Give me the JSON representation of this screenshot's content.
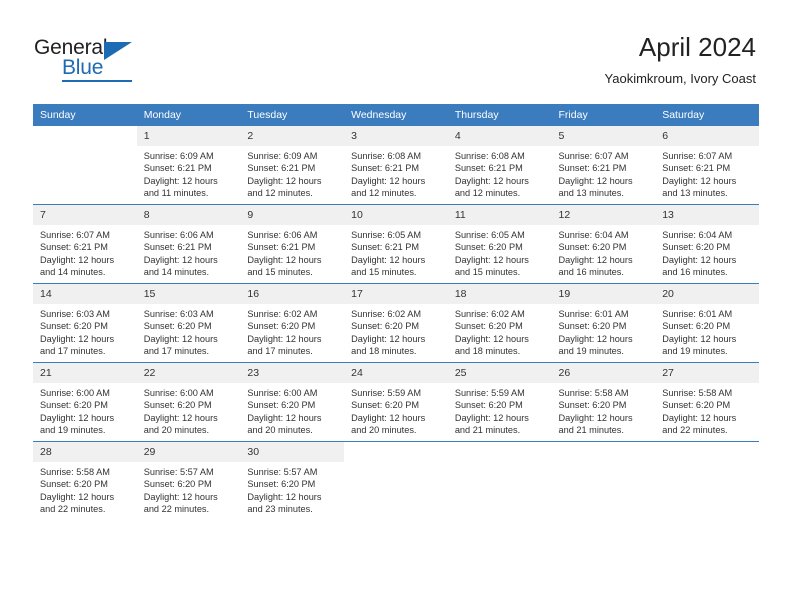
{
  "logo": {
    "word1": "General",
    "word2": "Blue",
    "triangle_color": "#1d6cb3",
    "text_color": "#231f20"
  },
  "header": {
    "title": "April 2024",
    "subtitle": "Yaokimkroum, Ivory Coast"
  },
  "theme": {
    "header_blue": "#3b7cbf",
    "daynum_band": "#f0f0f0",
    "text": "#333333"
  },
  "weekday_headers": [
    "Sunday",
    "Monday",
    "Tuesday",
    "Wednesday",
    "Thursday",
    "Friday",
    "Saturday"
  ],
  "weeks": [
    [
      {
        "day": "",
        "sunrise": "",
        "sunset": "",
        "daylight": ""
      },
      {
        "day": "1",
        "sunrise": "Sunrise: 6:09 AM",
        "sunset": "Sunset: 6:21 PM",
        "daylight": "Daylight: 12 hours and 11 minutes."
      },
      {
        "day": "2",
        "sunrise": "Sunrise: 6:09 AM",
        "sunset": "Sunset: 6:21 PM",
        "daylight": "Daylight: 12 hours and 12 minutes."
      },
      {
        "day": "3",
        "sunrise": "Sunrise: 6:08 AM",
        "sunset": "Sunset: 6:21 PM",
        "daylight": "Daylight: 12 hours and 12 minutes."
      },
      {
        "day": "4",
        "sunrise": "Sunrise: 6:08 AM",
        "sunset": "Sunset: 6:21 PM",
        "daylight": "Daylight: 12 hours and 12 minutes."
      },
      {
        "day": "5",
        "sunrise": "Sunrise: 6:07 AM",
        "sunset": "Sunset: 6:21 PM",
        "daylight": "Daylight: 12 hours and 13 minutes."
      },
      {
        "day": "6",
        "sunrise": "Sunrise: 6:07 AM",
        "sunset": "Sunset: 6:21 PM",
        "daylight": "Daylight: 12 hours and 13 minutes."
      }
    ],
    [
      {
        "day": "7",
        "sunrise": "Sunrise: 6:07 AM",
        "sunset": "Sunset: 6:21 PM",
        "daylight": "Daylight: 12 hours and 14 minutes."
      },
      {
        "day": "8",
        "sunrise": "Sunrise: 6:06 AM",
        "sunset": "Sunset: 6:21 PM",
        "daylight": "Daylight: 12 hours and 14 minutes."
      },
      {
        "day": "9",
        "sunrise": "Sunrise: 6:06 AM",
        "sunset": "Sunset: 6:21 PM",
        "daylight": "Daylight: 12 hours and 15 minutes."
      },
      {
        "day": "10",
        "sunrise": "Sunrise: 6:05 AM",
        "sunset": "Sunset: 6:21 PM",
        "daylight": "Daylight: 12 hours and 15 minutes."
      },
      {
        "day": "11",
        "sunrise": "Sunrise: 6:05 AM",
        "sunset": "Sunset: 6:20 PM",
        "daylight": "Daylight: 12 hours and 15 minutes."
      },
      {
        "day": "12",
        "sunrise": "Sunrise: 6:04 AM",
        "sunset": "Sunset: 6:20 PM",
        "daylight": "Daylight: 12 hours and 16 minutes."
      },
      {
        "day": "13",
        "sunrise": "Sunrise: 6:04 AM",
        "sunset": "Sunset: 6:20 PM",
        "daylight": "Daylight: 12 hours and 16 minutes."
      }
    ],
    [
      {
        "day": "14",
        "sunrise": "Sunrise: 6:03 AM",
        "sunset": "Sunset: 6:20 PM",
        "daylight": "Daylight: 12 hours and 17 minutes."
      },
      {
        "day": "15",
        "sunrise": "Sunrise: 6:03 AM",
        "sunset": "Sunset: 6:20 PM",
        "daylight": "Daylight: 12 hours and 17 minutes."
      },
      {
        "day": "16",
        "sunrise": "Sunrise: 6:02 AM",
        "sunset": "Sunset: 6:20 PM",
        "daylight": "Daylight: 12 hours and 17 minutes."
      },
      {
        "day": "17",
        "sunrise": "Sunrise: 6:02 AM",
        "sunset": "Sunset: 6:20 PM",
        "daylight": "Daylight: 12 hours and 18 minutes."
      },
      {
        "day": "18",
        "sunrise": "Sunrise: 6:02 AM",
        "sunset": "Sunset: 6:20 PM",
        "daylight": "Daylight: 12 hours and 18 minutes."
      },
      {
        "day": "19",
        "sunrise": "Sunrise: 6:01 AM",
        "sunset": "Sunset: 6:20 PM",
        "daylight": "Daylight: 12 hours and 19 minutes."
      },
      {
        "day": "20",
        "sunrise": "Sunrise: 6:01 AM",
        "sunset": "Sunset: 6:20 PM",
        "daylight": "Daylight: 12 hours and 19 minutes."
      }
    ],
    [
      {
        "day": "21",
        "sunrise": "Sunrise: 6:00 AM",
        "sunset": "Sunset: 6:20 PM",
        "daylight": "Daylight: 12 hours and 19 minutes."
      },
      {
        "day": "22",
        "sunrise": "Sunrise: 6:00 AM",
        "sunset": "Sunset: 6:20 PM",
        "daylight": "Daylight: 12 hours and 20 minutes."
      },
      {
        "day": "23",
        "sunrise": "Sunrise: 6:00 AM",
        "sunset": "Sunset: 6:20 PM",
        "daylight": "Daylight: 12 hours and 20 minutes."
      },
      {
        "day": "24",
        "sunrise": "Sunrise: 5:59 AM",
        "sunset": "Sunset: 6:20 PM",
        "daylight": "Daylight: 12 hours and 20 minutes."
      },
      {
        "day": "25",
        "sunrise": "Sunrise: 5:59 AM",
        "sunset": "Sunset: 6:20 PM",
        "daylight": "Daylight: 12 hours and 21 minutes."
      },
      {
        "day": "26",
        "sunrise": "Sunrise: 5:58 AM",
        "sunset": "Sunset: 6:20 PM",
        "daylight": "Daylight: 12 hours and 21 minutes."
      },
      {
        "day": "27",
        "sunrise": "Sunrise: 5:58 AM",
        "sunset": "Sunset: 6:20 PM",
        "daylight": "Daylight: 12 hours and 22 minutes."
      }
    ],
    [
      {
        "day": "28",
        "sunrise": "Sunrise: 5:58 AM",
        "sunset": "Sunset: 6:20 PM",
        "daylight": "Daylight: 12 hours and 22 minutes."
      },
      {
        "day": "29",
        "sunrise": "Sunrise: 5:57 AM",
        "sunset": "Sunset: 6:20 PM",
        "daylight": "Daylight: 12 hours and 22 minutes."
      },
      {
        "day": "30",
        "sunrise": "Sunrise: 5:57 AM",
        "sunset": "Sunset: 6:20 PM",
        "daylight": "Daylight: 12 hours and 23 minutes."
      },
      {
        "day": "",
        "sunrise": "",
        "sunset": "",
        "daylight": ""
      },
      {
        "day": "",
        "sunrise": "",
        "sunset": "",
        "daylight": ""
      },
      {
        "day": "",
        "sunrise": "",
        "sunset": "",
        "daylight": ""
      },
      {
        "day": "",
        "sunrise": "",
        "sunset": "",
        "daylight": ""
      }
    ]
  ]
}
